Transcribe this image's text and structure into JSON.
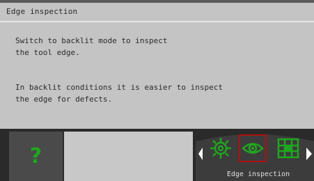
{
  "header": {
    "title": "Edge inspection"
  },
  "message": {
    "paragraph1": "Switch to backlit mode to inspect\nthe tool edge.",
    "paragraph2": "In backlit conditions it is easier to inspect\nthe edge for defects."
  },
  "footer": {
    "help_label": "?",
    "help_icon": "question-mark-icon",
    "carousel": {
      "selected_label": "Edge inspection",
      "items": [
        {
          "icon": "gear-inspection-icon",
          "selected": false
        },
        {
          "icon": "eye-backlit-icon",
          "selected": true
        },
        {
          "icon": "grid-inspection-icon",
          "selected": false
        }
      ]
    }
  },
  "colors": {
    "background": "#c4c4c4",
    "footer": "#2a2a2a",
    "accent_green": "#1fa61f",
    "selection_red": "#b01010"
  }
}
